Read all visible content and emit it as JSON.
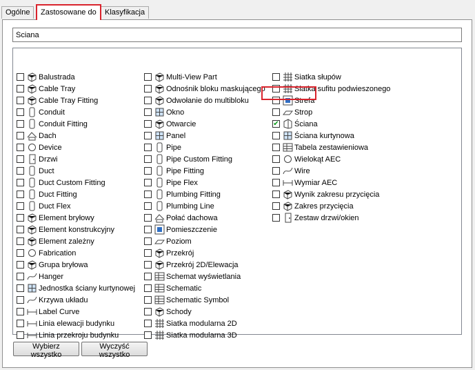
{
  "tabs": [
    {
      "label": "Ogólne"
    },
    {
      "label": "Zastosowane do"
    },
    {
      "label": "Klasyfikacja"
    }
  ],
  "search": {
    "value": "Ściana"
  },
  "columns": [
    [
      {
        "label": "Balustrada",
        "icon": "railing-icon",
        "checked": false
      },
      {
        "label": "Cable Tray",
        "icon": "cable-tray-icon",
        "checked": false
      },
      {
        "label": "Cable Tray Fitting",
        "icon": "cable-tray-fitting-icon",
        "checked": false
      },
      {
        "label": "Conduit",
        "icon": "conduit-icon",
        "checked": false
      },
      {
        "label": "Conduit Fitting",
        "icon": "conduit-fitting-icon",
        "checked": false
      },
      {
        "label": "Dach",
        "icon": "roof-icon",
        "checked": false
      },
      {
        "label": "Device",
        "icon": "device-icon",
        "checked": false
      },
      {
        "label": "Drzwi",
        "icon": "door-icon",
        "checked": false
      },
      {
        "label": "Duct",
        "icon": "duct-icon",
        "checked": false
      },
      {
        "label": "Duct Custom Fitting",
        "icon": "duct-custom-fitting-icon",
        "checked": false
      },
      {
        "label": "Duct Fitting",
        "icon": "duct-fitting-icon",
        "checked": false
      },
      {
        "label": "Duct Flex",
        "icon": "duct-flex-icon",
        "checked": false
      },
      {
        "label": "Element bryłowy",
        "icon": "mass-element-icon",
        "checked": false
      },
      {
        "label": "Element konstrukcyjny",
        "icon": "structural-member-icon",
        "checked": false
      },
      {
        "label": "Element zależny",
        "icon": "dependent-element-icon",
        "checked": false
      },
      {
        "label": "Fabrication",
        "icon": "fabrication-icon",
        "checked": false
      },
      {
        "label": "Grupa bryłowa",
        "icon": "mass-group-icon",
        "checked": false
      },
      {
        "label": "Hanger",
        "icon": "hanger-icon",
        "checked": false
      },
      {
        "label": "Jednostka ściany kurtynowej",
        "icon": "curtain-wall-unit-icon",
        "checked": false
      },
      {
        "label": "Krzywa układu",
        "icon": "layout-curve-icon",
        "checked": false
      },
      {
        "label": "Label Curve",
        "icon": "label-curve-icon",
        "checked": false
      },
      {
        "label": "Linia elewacji budynku",
        "icon": "elevation-line-icon",
        "checked": false
      },
      {
        "label": "Linia przekroju budynku",
        "icon": "section-line-icon",
        "checked": false
      }
    ],
    [
      {
        "label": "Multi-View Part",
        "icon": "multi-view-part-icon",
        "checked": false
      },
      {
        "label": "Odnośnik bloku maskującego",
        "icon": "mask-block-reference-icon",
        "checked": false
      },
      {
        "label": "Odwołanie do multibloku",
        "icon": "multi-view-block-reference-icon",
        "checked": false
      },
      {
        "label": "Okno",
        "icon": "window-icon",
        "checked": false
      },
      {
        "label": "Otwarcie",
        "icon": "opening-icon",
        "checked": false
      },
      {
        "label": "Panel",
        "icon": "panel-icon",
        "checked": false
      },
      {
        "label": "Pipe",
        "icon": "pipe-icon",
        "checked": false
      },
      {
        "label": "Pipe Custom Fitting",
        "icon": "pipe-custom-fitting-icon",
        "checked": false
      },
      {
        "label": "Pipe Fitting",
        "icon": "pipe-fitting-icon",
        "checked": false
      },
      {
        "label": "Pipe Flex",
        "icon": "pipe-flex-icon",
        "checked": false
      },
      {
        "label": "Plumbing Fitting",
        "icon": "plumbing-fitting-icon",
        "checked": false
      },
      {
        "label": "Plumbing Line",
        "icon": "plumbing-line-icon",
        "checked": false
      },
      {
        "label": "Połać dachowa",
        "icon": "roof-slab-icon",
        "checked": false
      },
      {
        "label": "Pomieszczenie",
        "icon": "space-icon",
        "checked": false
      },
      {
        "label": "Poziom",
        "icon": "level-icon",
        "checked": false
      },
      {
        "label": "Przekrój",
        "icon": "section-icon",
        "checked": false
      },
      {
        "label": "Przekrój 2D/Elewacja",
        "icon": "section-2d-elevation-icon",
        "checked": false
      },
      {
        "label": "Schemat wyświetlania",
        "icon": "display-schematic-icon",
        "checked": false
      },
      {
        "label": "Schematic",
        "icon": "schematic-icon",
        "checked": false
      },
      {
        "label": "Schematic Symbol",
        "icon": "schematic-symbol-icon",
        "checked": false
      },
      {
        "label": "Schody",
        "icon": "stair-icon",
        "checked": false
      },
      {
        "label": "Siatka modularna 2D",
        "icon": "grid-2d-icon",
        "checked": false
      },
      {
        "label": "Siatka modularna 3D",
        "icon": "grid-3d-icon",
        "checked": false
      }
    ],
    [
      {
        "label": "Siatka słupów",
        "icon": "column-grid-icon",
        "checked": false
      },
      {
        "label": "Siatka sufitu podwieszonego",
        "icon": "ceiling-grid-icon",
        "checked": false
      },
      {
        "label": "Strefa",
        "icon": "zone-icon",
        "checked": false
      },
      {
        "label": "Strop",
        "icon": "slab-icon",
        "checked": false
      },
      {
        "label": "Ściana",
        "icon": "wall-icon",
        "checked": true
      },
      {
        "label": "Ściana kurtynowa",
        "icon": "curtain-wall-icon",
        "checked": false
      },
      {
        "label": "Tabela zestawieniowa",
        "icon": "schedule-table-icon",
        "checked": false
      },
      {
        "label": "Wielokąt AEC",
        "icon": "aec-polygon-icon",
        "checked": false
      },
      {
        "label": "Wire",
        "icon": "wire-icon",
        "checked": false
      },
      {
        "label": "Wymiar AEC",
        "icon": "aec-dimension-icon",
        "checked": false
      },
      {
        "label": "Wynik zakresu przycięcia",
        "icon": "clip-result-icon",
        "checked": false
      },
      {
        "label": "Zakres przycięcia",
        "icon": "clip-range-icon",
        "checked": false
      },
      {
        "label": "Zestaw drzwi/okien",
        "icon": "door-window-assembly-icon",
        "checked": false
      }
    ]
  ],
  "buttons": {
    "select_all": "Wybierz wszystko",
    "clear_all": "Wyczyść wszystko"
  },
  "colors": {
    "highlight": "#d9232c",
    "check": "#0a9b19",
    "icon_blue": "#2f6fc4"
  }
}
